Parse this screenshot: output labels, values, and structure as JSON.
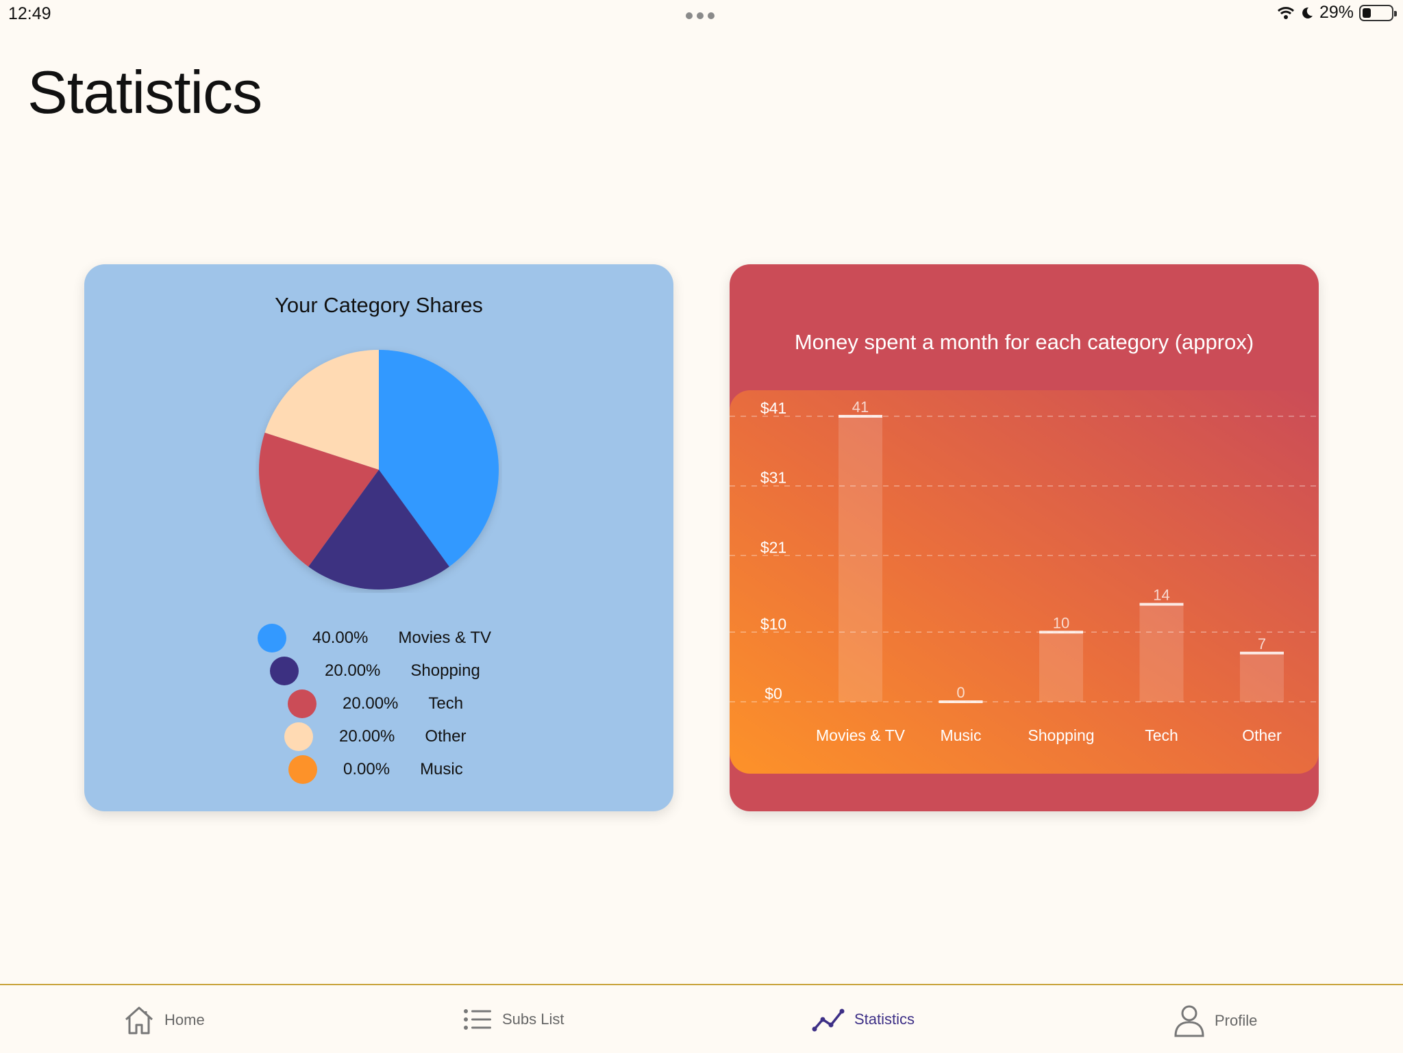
{
  "status_bar": {
    "time": "12:49",
    "battery": "29%",
    "battery_level": 0.29
  },
  "page": {
    "title": "Statistics"
  },
  "pie_card": {
    "title": "Your Category Shares",
    "legend": [
      {
        "color": "#3399ff",
        "percent": "40.00%",
        "label": "Movies & TV"
      },
      {
        "color": "#3c3081",
        "percent": "20.00%",
        "label": "Shopping"
      },
      {
        "color": "#cb4c57",
        "percent": "20.00%",
        "label": "Tech"
      },
      {
        "color": "#ffdab3",
        "percent": "20.00%",
        "label": "Other"
      },
      {
        "color": "#fd9229",
        "percent": "0.00%",
        "label": "Music"
      }
    ]
  },
  "bar_card": {
    "title": "Money spent a month for each category (approx)"
  },
  "chart_data": [
    {
      "type": "pie",
      "title": "Your Category Shares",
      "categories": [
        "Movies & TV",
        "Shopping",
        "Tech",
        "Other",
        "Music"
      ],
      "values": [
        40,
        20,
        20,
        20,
        0
      ],
      "colors": [
        "#3399ff",
        "#3c3081",
        "#cb4c57",
        "#ffdab3",
        "#fd9229"
      ]
    },
    {
      "type": "bar",
      "title": "Money spent a month for each category (approx)",
      "categories": [
        "Movies & TV",
        "Music",
        "Shopping",
        "Tech",
        "Other"
      ],
      "values": [
        41,
        0,
        10,
        14,
        7
      ],
      "ylim": [
        0,
        41
      ],
      "yticks": [
        0,
        10,
        21,
        31,
        41
      ],
      "ytick_labels": [
        "$0",
        "$10",
        "$21",
        "$31",
        "$41"
      ],
      "grid": true
    }
  ],
  "nav": {
    "items": [
      {
        "label": "Home",
        "icon": "home-icon",
        "active": false
      },
      {
        "label": "Subs List",
        "icon": "list-icon",
        "active": false
      },
      {
        "label": "Statistics",
        "icon": "chart-line-icon",
        "active": true
      },
      {
        "label": "Profile",
        "icon": "person-icon",
        "active": false
      }
    ]
  },
  "colors": {
    "background": "#fefaf4",
    "pie_card": "#9fc4e9",
    "bar_card": "#cb4c57",
    "active_nav": "#3d2f86"
  }
}
